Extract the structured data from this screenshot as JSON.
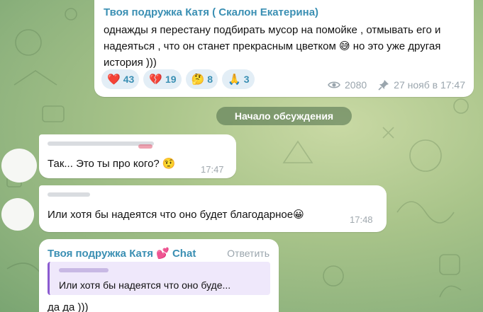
{
  "post": {
    "author": "Твоя подружка Катя ( Скалон Екатерина)",
    "text": "однажды я перестану подбирать мусор на помойке , отмывать его и надеяться , что он станет прекрасным цветком 😅 но это уже другая история )))",
    "reactions": [
      {
        "emoji": "❤️",
        "count": "43",
        "icon": "red-heart-icon"
      },
      {
        "emoji": "💔",
        "count": "19",
        "icon": "broken-heart-icon"
      },
      {
        "emoji": "🤔",
        "count": "8",
        "icon": "thinking-face-icon"
      },
      {
        "emoji": "🙏",
        "count": "3",
        "icon": "folded-hands-icon"
      }
    ],
    "views": "2080",
    "date": "27 нояб в 17:47",
    "views_icon": "eye-icon",
    "pin_icon": "pin-icon"
  },
  "divider": {
    "label": "Начало обсуждения"
  },
  "comments": [
    {
      "text": "Так... Это ты про кого? 🤨",
      "time": "17:47"
    },
    {
      "text": "Или хотя бы надеятся что оно будет благодарное😀",
      "time": "17:48"
    }
  ],
  "reply_comment": {
    "author": "Твоя подружка Катя 💕 Chat",
    "reply_label": "Ответить",
    "quote_text": "Или хотя бы надеятся что оно буде...",
    "text": "да да )))"
  },
  "colors": {
    "accent": "#3a8fb3",
    "reaction_bg": "#e3eef6",
    "quote_bar": "#8b5bd0",
    "quote_bg": "#efe8fb",
    "divider_bg": "#4a6c48"
  }
}
